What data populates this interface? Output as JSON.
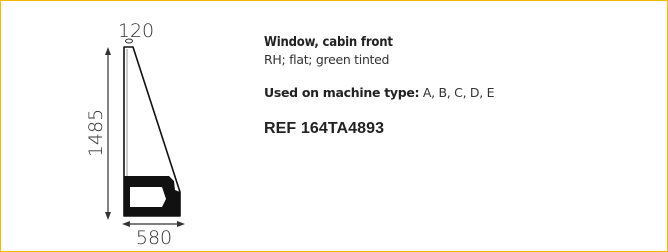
{
  "product": {
    "title": "Window, cabin front",
    "subtitle": "RH; flat; green tinted",
    "machine_label": "Used on machine type:",
    "machine_types": " A, B, C, D, E",
    "reference": "REF 164TA4893"
  },
  "drawing": {
    "dim_top": "120",
    "dim_height": "1485",
    "dim_width": "580"
  },
  "colors": {
    "border": "#f3b700"
  }
}
